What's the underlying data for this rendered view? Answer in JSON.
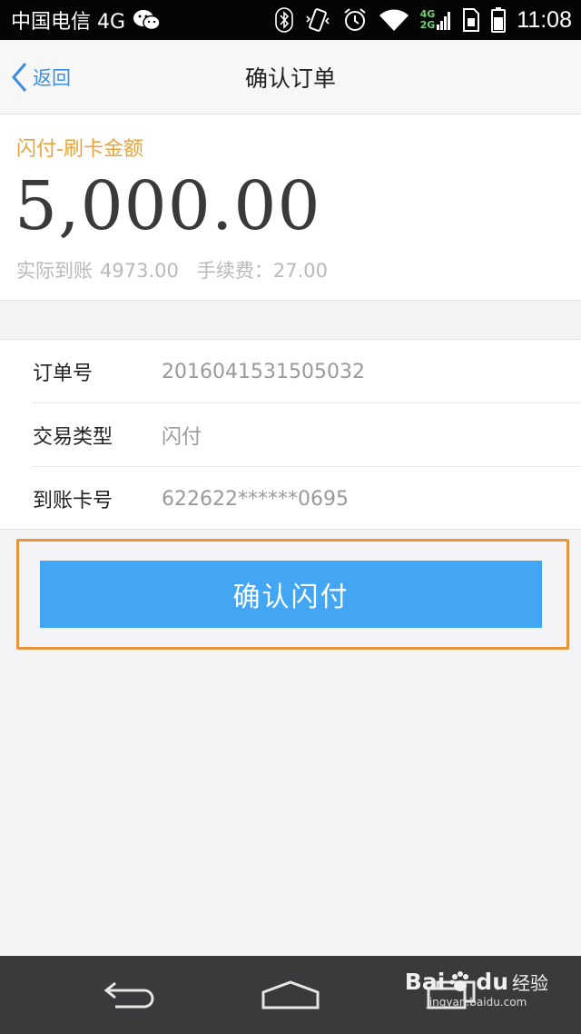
{
  "status_bar": {
    "carrier": "中国电信 4G",
    "network_badge_top": "4G",
    "network_badge_bottom": "2G",
    "time": "11:08",
    "icons": [
      "wechat-icon",
      "bluetooth-icon",
      "vibrate-icon",
      "alarm-icon",
      "wifi-icon",
      "signal-icon",
      "sim-icon",
      "battery-icon"
    ]
  },
  "nav": {
    "back_label": "返回",
    "title": "确认订单"
  },
  "amount": {
    "label": "闪付-刷卡金额",
    "value": "5,000.00",
    "received_label": "实际到账",
    "received_value": "4973.00",
    "fee_label": "手续费：",
    "fee_value": "27.00"
  },
  "details": [
    {
      "label": "订单号",
      "value": "2016041531505032"
    },
    {
      "label": "交易类型",
      "value": "闪付"
    },
    {
      "label": "到账卡号",
      "value": "622622******0695"
    }
  ],
  "confirm_button": {
    "label": "确认闪付"
  },
  "watermark": {
    "brand": "Bai",
    "brand_suffix": "du",
    "brand_zh": "经验",
    "sub": "jingyan.baidu.com"
  },
  "colors": {
    "accent_blue": "#42a6f5",
    "link_blue": "#3a8de0",
    "label_orange": "#e8a33b",
    "highlight_orange": "#e8943a"
  }
}
